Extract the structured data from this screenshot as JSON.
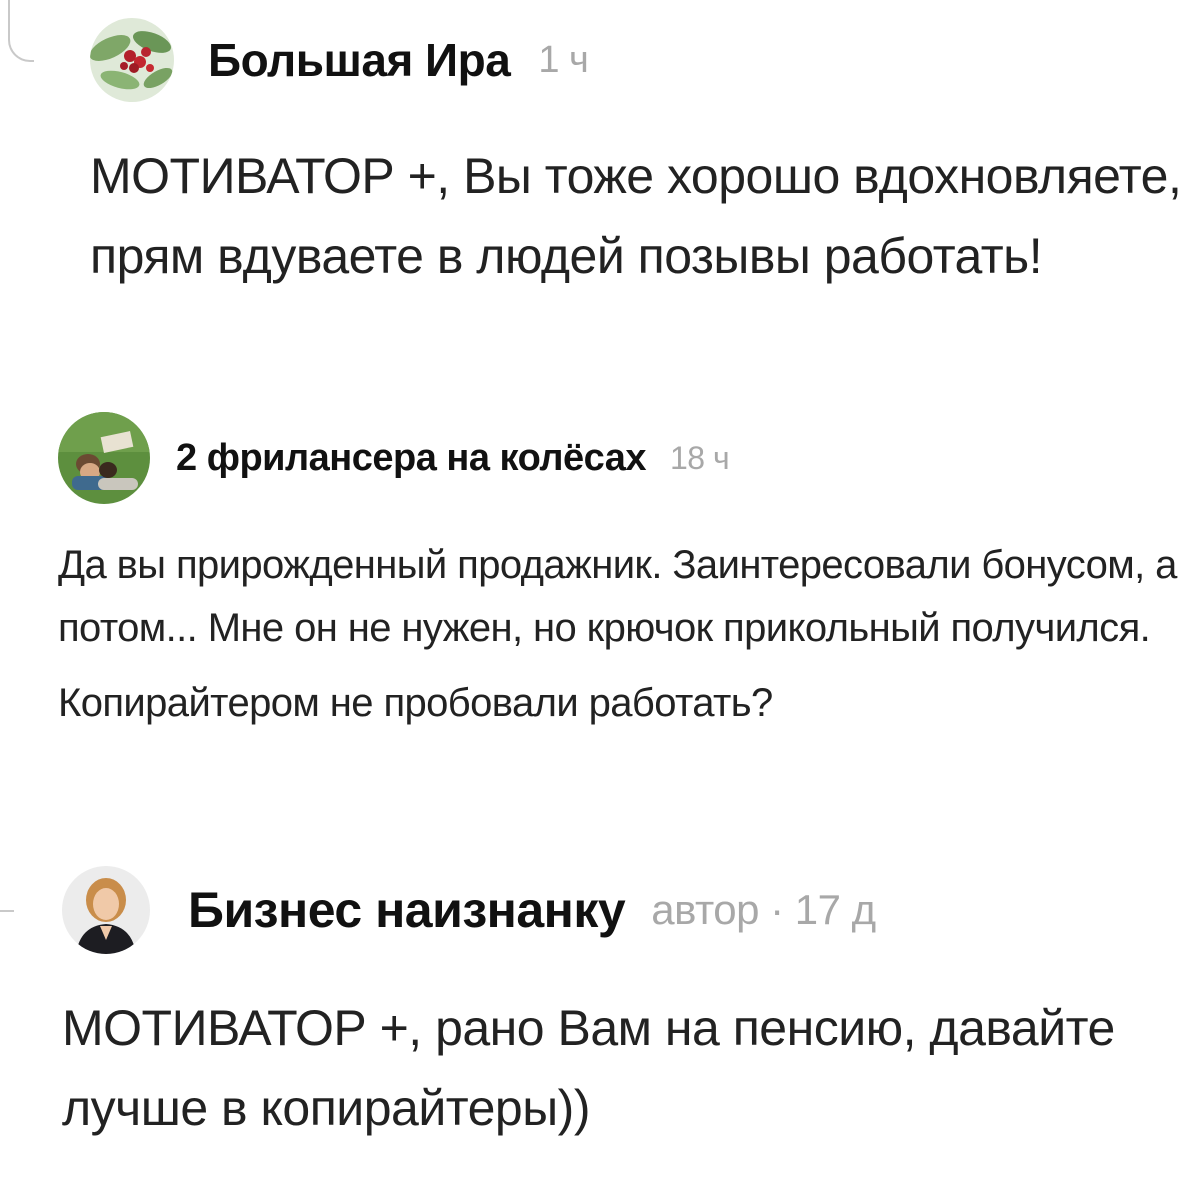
{
  "comments": [
    {
      "author": "Большая Ира",
      "meta": "1 ч",
      "avatar_icon": "cherries-avatar",
      "text": [
        "МОТИВАТОР +, Вы тоже хорошо вдохновляете, прям вдуваете в людей позывы работать!"
      ]
    },
    {
      "author": "2 фрилансера на колёсах",
      "meta": "18 ч",
      "avatar_icon": "couple-on-grass-avatar",
      "text": [
        "Да вы прирожденный продажник. Заинтересовали бонусом, а потом... Мне он не нужен, но крючок прикольный получился.",
        "Копирайтером не пробовали работать?"
      ]
    },
    {
      "author": "Бизнес наизнанку",
      "meta": "автор · 17 д",
      "avatar_icon": "woman-portrait-avatar",
      "text": [
        "МОТИВАТОР +, рано Вам на пенсию, давайте лучше в копирайтеры))"
      ]
    }
  ],
  "colors": {
    "meta": "#a8a8a8",
    "thread_line": "#c9c9c9",
    "text": "#222222"
  }
}
